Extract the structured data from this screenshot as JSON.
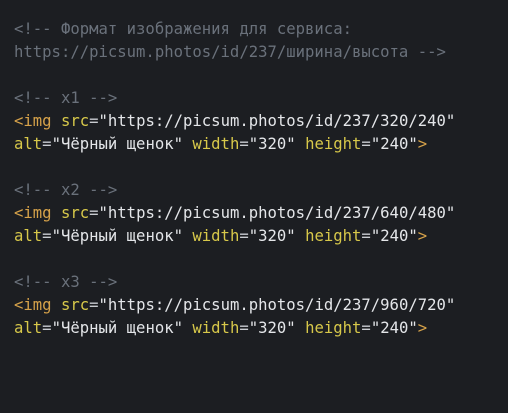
{
  "comment_format": {
    "line1": "<!-- Формат изображения для сервиса:",
    "line2": "https://picsum.photos/id/237/ширина/высота -->"
  },
  "blocks": [
    {
      "comment": "<!-- x1 -->",
      "tag_open": "<img",
      "attr_src": "src",
      "val_src": "\"https://picsum.photos/id/237/320/240\"",
      "attr_alt": "alt",
      "val_alt": "\"Чёрный щенок\"",
      "attr_width": "width",
      "val_width": "\"320\"",
      "attr_height": "height",
      "val_height": "\"240\"",
      "tag_close": ">"
    },
    {
      "comment": "<!-- x2 -->",
      "tag_open": "<img",
      "attr_src": "src",
      "val_src": "\"https://picsum.photos/id/237/640/480\"",
      "attr_alt": "alt",
      "val_alt": "\"Чёрный щенок\"",
      "attr_width": "width",
      "val_width": "\"320\"",
      "attr_height": "height",
      "val_height": "\"240\"",
      "tag_close": ">"
    },
    {
      "comment": "<!-- x3 -->",
      "tag_open": "<img",
      "attr_src": "src",
      "val_src": "\"https://picsum.photos/id/237/960/720\"",
      "attr_alt": "alt",
      "val_alt": "\"Чёрный щенок\"",
      "attr_width": "width",
      "val_width": "\"320\"",
      "attr_height": "height",
      "val_height": "\"240\"",
      "tag_close": ">"
    }
  ],
  "equals": "=",
  "colors": {
    "background": "#1c1e22",
    "comment": "#6a717b",
    "tag": "#d6a24a",
    "attribute": "#d7c84a",
    "string": "#e4e6e9"
  }
}
